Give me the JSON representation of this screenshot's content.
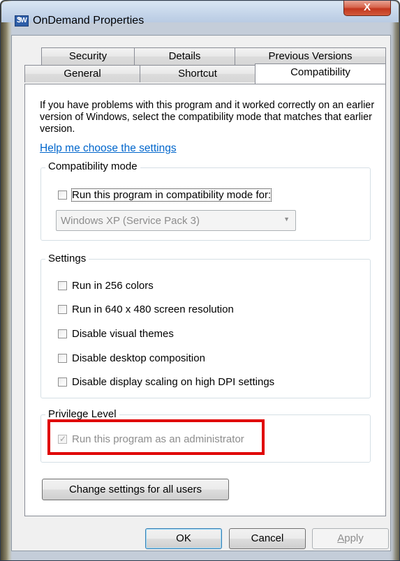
{
  "window": {
    "title": "OnDemand Properties",
    "icon_text": "ᏕW",
    "close_glyph": "X"
  },
  "tabs": [
    {
      "label": "Security"
    },
    {
      "label": "Details"
    },
    {
      "label": "Previous Versions"
    },
    {
      "label": "General"
    },
    {
      "label": "Shortcut"
    },
    {
      "label": "Compatibility",
      "active": true
    }
  ],
  "intro_text": "If you have problems with this program and it worked correctly on an earlier version of Windows, select the compatibility mode that matches that earlier version.",
  "help_link": "Help me choose the settings",
  "compatibility_mode": {
    "title": "Compatibility mode",
    "checkbox_label": "Run this program in compatibility mode for:",
    "checked": false,
    "select_value": "Windows XP (Service Pack 3)"
  },
  "settings": {
    "title": "Settings",
    "options": [
      {
        "label": "Run in 256 colors",
        "checked": false
      },
      {
        "label": "Run in 640 x 480 screen resolution",
        "checked": false
      },
      {
        "label": "Disable visual themes",
        "checked": false
      },
      {
        "label": "Disable desktop composition",
        "checked": false
      },
      {
        "label": "Disable display scaling on high DPI settings",
        "checked": false
      }
    ]
  },
  "privilege_level": {
    "title": "Privilege Level",
    "checkbox_label": "Run this program as an administrator",
    "checked": true,
    "disabled": true
  },
  "change_settings_button": "Change settings for all users",
  "footer_buttons": {
    "ok": "OK",
    "cancel": "Cancel",
    "apply_prefix": "A",
    "apply_rest": "pply"
  },
  "colors": {
    "link": "#0066cc",
    "highlight_border": "#e00000",
    "disabled_text": "#8d8d8d"
  }
}
